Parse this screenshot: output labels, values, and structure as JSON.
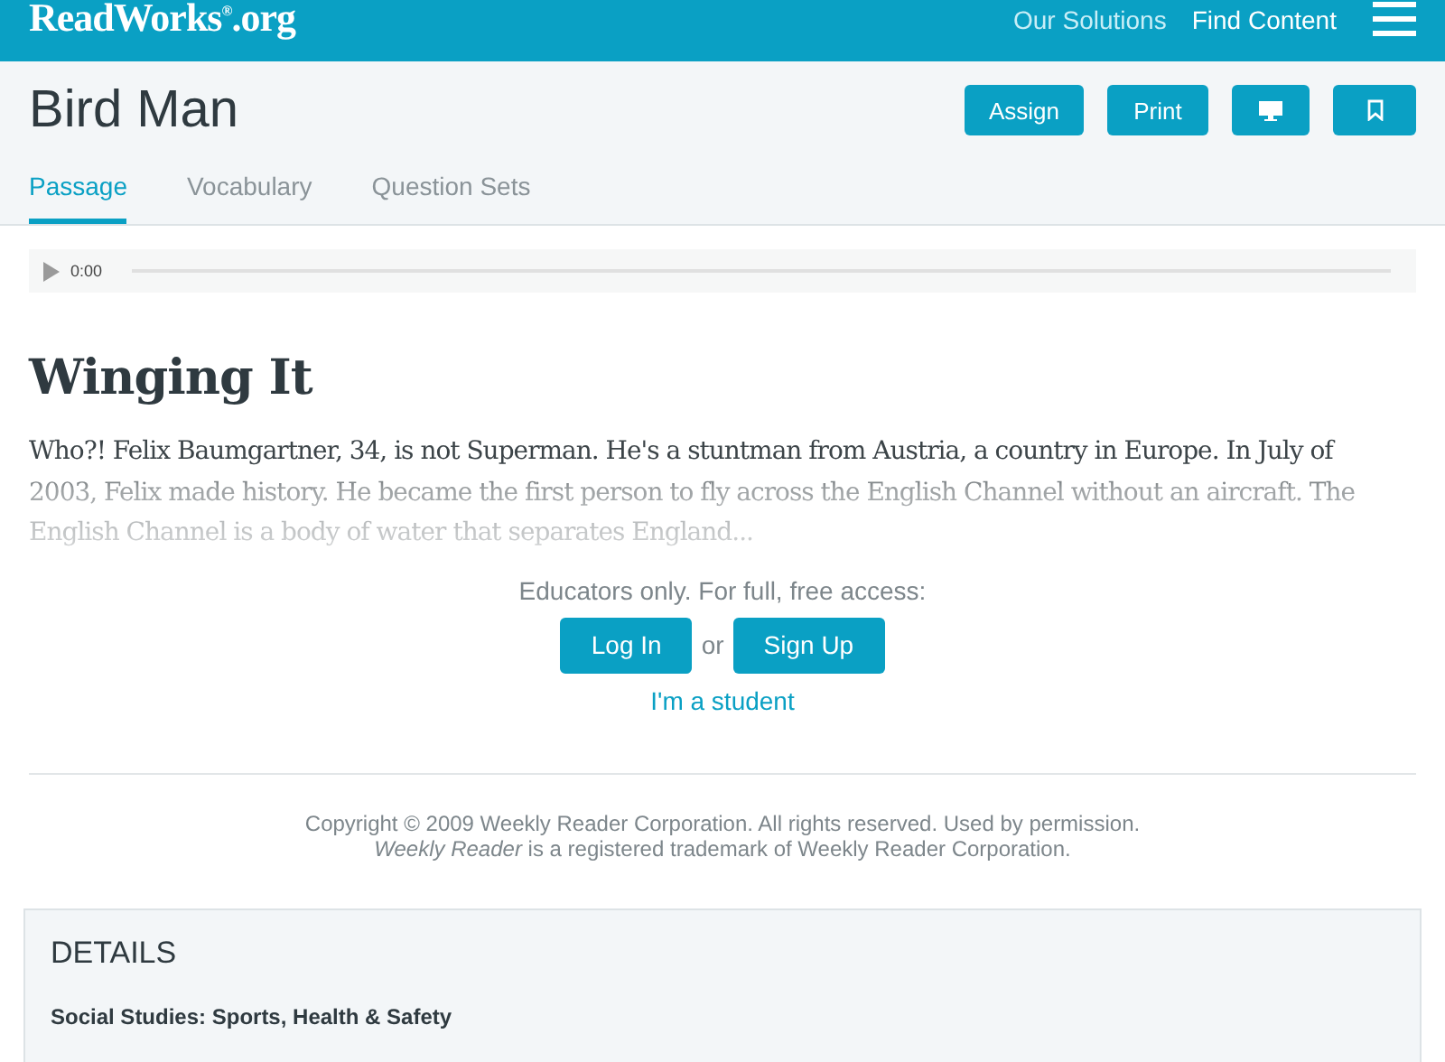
{
  "header": {
    "logo": "ReadWorks$^{®}$.org",
    "nav": [
      "Our Solutions",
      "Find Content"
    ]
  },
  "title": "Bird Man",
  "actions": [
    {
      "kind": "text",
      "label": "Assign"
    },
    {
      "kind": "text",
      "label": "Print"
    },
    {
      "kind": "monitor"
    },
    {
      "kind": "bookmark"
    }
  ],
  "tabs": [
    {
      "label": "Passage",
      "selected": true
    },
    {
      "label": "Vocabulary",
      "selected": false
    },
    {
      "label": "Question Sets",
      "selected": false
    }
  ],
  "audio": {
    "time": "0:00"
  },
  "article": {
    "heading": "Winging It",
    "text": "Who?! Felix Baumgartner, 34, is not Superman. He's a stuntman from Austria, a country in Europe. In July of 2003, Felix made history. He became the first person to fly across the English Channel without an aircraft. The English Channel is a body of water that separates England..."
  },
  "access": {
    "prompt": "Educators only. For full, free access:",
    "login": "Log In",
    "or": "or",
    "signup": "Sign Up",
    "student": "I'm a student"
  },
  "copyright": [
    "Copyright © 2009 Weekly Reader Corporation. All rights reserved. Used by permission.",
    "*Weekly Reader* is a registered trademark of Weekly Reader Corporation."
  ],
  "details": {
    "heading": "DETAILS",
    "subject": "Social Studies: Sports, Health & Safety"
  }
}
